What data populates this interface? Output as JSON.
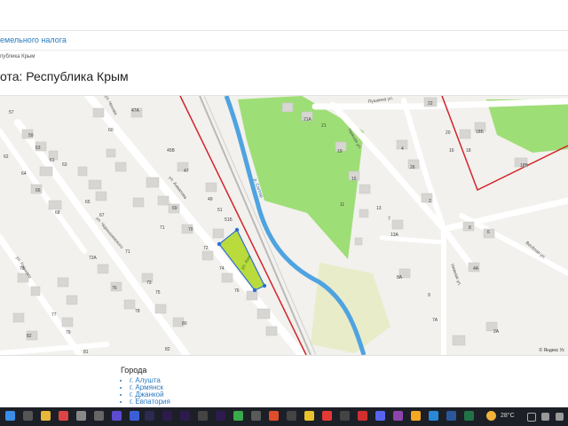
{
  "page": {
    "nav_link": "емельного налога",
    "breadcrumb": "публика Крым",
    "heading": "ота: Республика Крым"
  },
  "map": {
    "attribution": "© Яндекс",
    "attribution_tail": "Ус",
    "streets": {
      "akhmatova": "ул. Ахматова",
      "akhmatova_short": "ул. Ахм",
      "chekhova": "ул. Чехова",
      "chernyshevskogo": "ул. Чернышевского",
      "gorkogo": "ул. Горького",
      "pushkina": "Пушкина ул.",
      "nizhnyaya": "Нижняя ул.",
      "nizhnyaya2": "Нижняя ул.",
      "vesyolaya": "Весёлая ул.",
      "river": "р. Салгир"
    },
    "house_numbers": {
      "h45v": "45В",
      "h47a": "47А",
      "h47": "47",
      "h49": "49",
      "h51": "51",
      "h51b": "51Б",
      "h59": "59",
      "h60": "60",
      "h61": "61",
      "h62": "62",
      "h63": "63",
      "h64": "64",
      "h65": "65",
      "h66": "66",
      "h67": "67",
      "h68": "68",
      "h69": "69",
      "h70": "70",
      "h71": "71",
      "h72": "72",
      "h72a": "72А",
      "h73": "73",
      "h73b": "73",
      "h74": "74",
      "h75": "75",
      "h76": "76",
      "h76b": "76",
      "h77": "77",
      "h78": "78",
      "h79": "79",
      "h80": "80",
      "h82": "82",
      "h82b": "82",
      "h81": "81",
      "h21a": "21А",
      "h21": "21",
      "h19": "19",
      "h15": "15",
      "h11": "11",
      "h13": "13",
      "h13a": "13А",
      "h7": "7",
      "h4": "4",
      "h26": "26",
      "h2": "2",
      "h22": "22",
      "h20": "20",
      "h18b": "18Б",
      "h16": "16",
      "h18": "18",
      "h18v": "18В",
      "h8": "8",
      "h9": "9",
      "h7a": "7А",
      "h8a": "8А",
      "h4a": "4А",
      "h2a": "2А",
      "h6": "6",
      "h57": "57",
      "h63b": "63",
      "h71b": "71"
    }
  },
  "cities": {
    "title": "Города",
    "items": [
      "г. Алушта",
      "г. Армянск",
      "г. Джанкой",
      "г. Евпатория"
    ]
  },
  "taskbar": {
    "weather": "28°C"
  },
  "colors": {
    "link": "#2a7ac0",
    "parcel_fill": "#b9dc3c",
    "parcel_stroke": "#2c6fd6",
    "boundary": "#d3222a",
    "river": "#4fa3e0",
    "park": "#9ede77"
  }
}
